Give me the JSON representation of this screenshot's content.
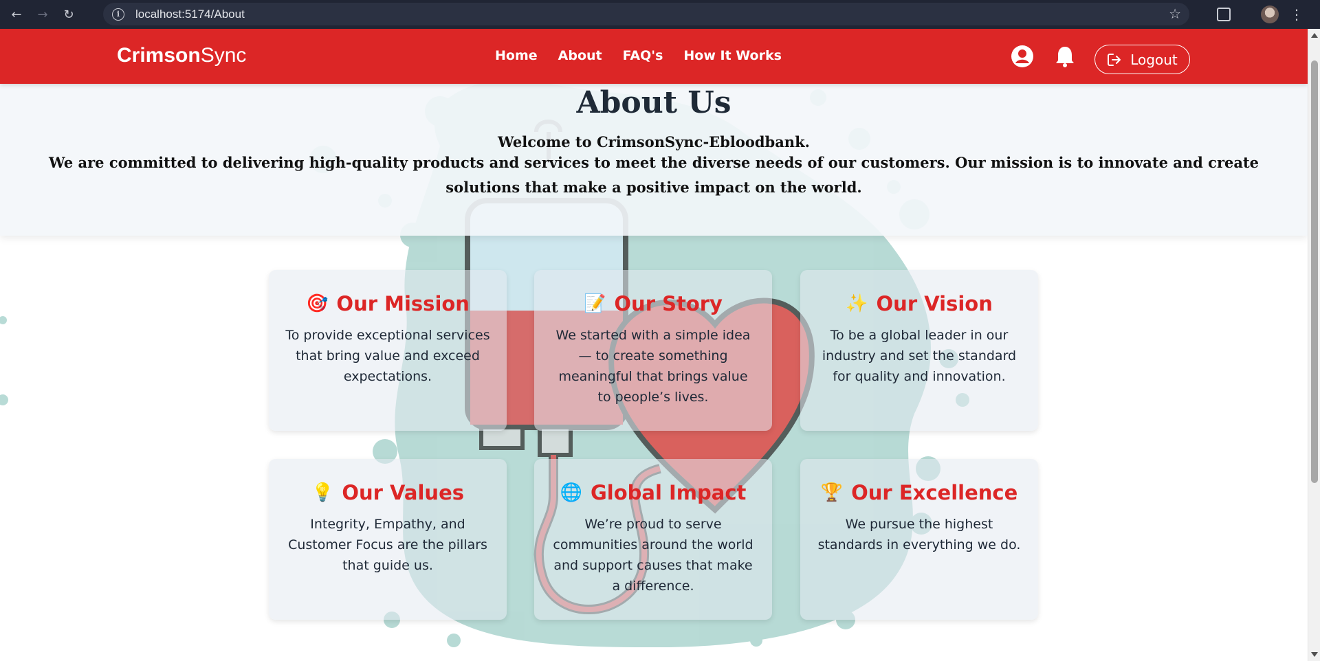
{
  "browser": {
    "url": "localhost:5174/About"
  },
  "navbar": {
    "brand_bold": "Crimson",
    "brand_light": "Sync",
    "links": [
      "Home",
      "About",
      "FAQ's",
      "How It Works"
    ],
    "logout_label": "Logout"
  },
  "hero": {
    "title": "About Us",
    "welcome": "Welcome to CrimsonSync-Ebloodbank.",
    "description": "We are committed to delivering high-quality products and services to meet the diverse needs of our customers. Our mission is to innovate and create solutions that make a positive impact on the world."
  },
  "cards": [
    {
      "icon": "🎯",
      "title": "Our Mission",
      "text": "To provide exceptional services that bring value and exceed expectations."
    },
    {
      "icon": "📝",
      "title": "Our Story",
      "text": "We started with a simple idea — to create something meaningful that brings value to people’s lives."
    },
    {
      "icon": "✨",
      "title": "Our Vision",
      "text": "To be a global leader in our industry and set the standard for quality and innovation."
    },
    {
      "icon": "💡",
      "title": "Our Values",
      "text": "Integrity, Empathy, and Customer Focus are the pillars that guide us."
    },
    {
      "icon": "🌐",
      "title": "Global Impact",
      "text": "We’re proud to serve communities around the world and support causes that make a difference."
    },
    {
      "icon": "🏆",
      "title": "Our Excellence",
      "text": "We pursue the highest standards in everything we do."
    }
  ],
  "colors": {
    "brand_red": "#dc2626",
    "heading_dark": "#1f2a37",
    "illustration_teal": "#9cccc6"
  }
}
